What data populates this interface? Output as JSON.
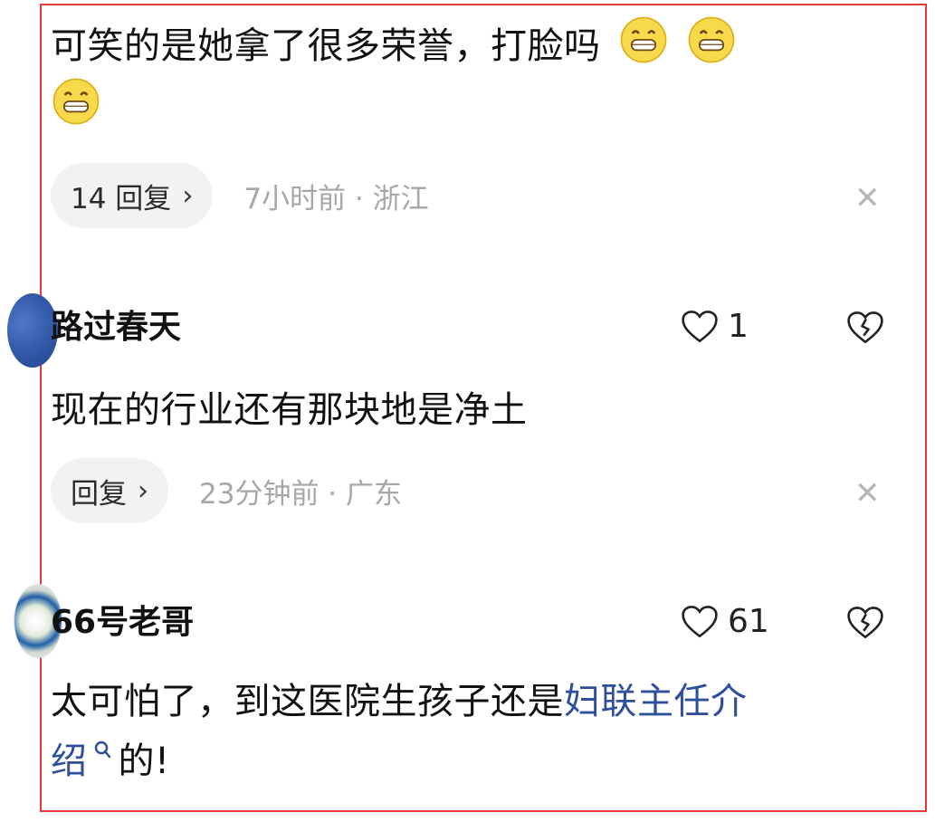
{
  "comments": [
    {
      "text": "可笑的是她拿了很多荣誉，打脸吗",
      "emojis": [
        "grinning-face-emoji",
        "grinning-face-emoji",
        "grinning-face-emoji"
      ],
      "reply_label": "14 回复",
      "meta": "7小时前 · 浙江"
    },
    {
      "username": "路过春天",
      "likes": "1",
      "text": "现在的行业还有那块地是净土",
      "reply_label": "回复",
      "meta": "23分钟前 · 广东"
    },
    {
      "username": "66号老哥",
      "likes": "61",
      "text_before_link": "太可怕了，到这医院生孩子还是",
      "link_line1": "妇联主任介",
      "link_line2": "绍",
      "text_after_link": "的!"
    }
  ],
  "icons": {
    "chevron": "chevron-right-icon",
    "close": "close-icon",
    "like": "heart-icon",
    "dislike": "broken-heart-icon",
    "search": "search-icon"
  },
  "colors": {
    "frame": "#e53935",
    "link": "#2f4f9d",
    "meta": "#a7a7ab",
    "pill": "#f2f2f4"
  }
}
